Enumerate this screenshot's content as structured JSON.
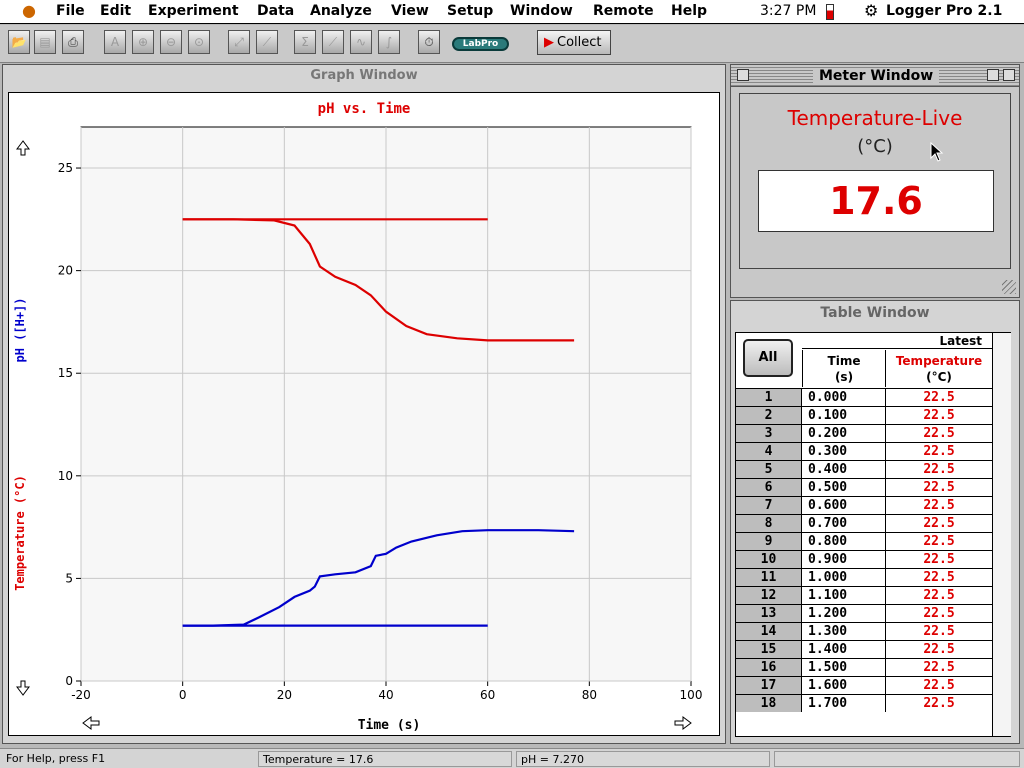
{
  "menubar": {
    "items": [
      "File",
      "Edit",
      "Experiment",
      "Data",
      "Analyze",
      "View",
      "Setup",
      "Window",
      "Remote",
      "Help"
    ],
    "clock": "3:27 PM",
    "app_name": "Logger Pro 2.1"
  },
  "toolbar": {
    "collect_label": "Collect",
    "labpro_label": "LabPro"
  },
  "graph_window": {
    "title": "Graph Window",
    "chart_title": "pH vs. Time"
  },
  "meter_window": {
    "title": "Meter Window",
    "label": "Temperature-Live",
    "unit": "(°C)",
    "value": "17.6"
  },
  "table_window": {
    "title": "Table Window",
    "all_label": "All",
    "latest_label": "Latest",
    "time_header": "Time",
    "time_unit": "(s)",
    "temp_header": "Temperature",
    "temp_unit": "(°C)",
    "rows": [
      {
        "n": "1",
        "t": "0.000",
        "v": "22.5"
      },
      {
        "n": "2",
        "t": "0.100",
        "v": "22.5"
      },
      {
        "n": "3",
        "t": "0.200",
        "v": "22.5"
      },
      {
        "n": "4",
        "t": "0.300",
        "v": "22.5"
      },
      {
        "n": "5",
        "t": "0.400",
        "v": "22.5"
      },
      {
        "n": "6",
        "t": "0.500",
        "v": "22.5"
      },
      {
        "n": "7",
        "t": "0.600",
        "v": "22.5"
      },
      {
        "n": "8",
        "t": "0.700",
        "v": "22.5"
      },
      {
        "n": "9",
        "t": "0.800",
        "v": "22.5"
      },
      {
        "n": "10",
        "t": "0.900",
        "v": "22.5"
      },
      {
        "n": "11",
        "t": "1.000",
        "v": "22.5"
      },
      {
        "n": "12",
        "t": "1.100",
        "v": "22.5"
      },
      {
        "n": "13",
        "t": "1.200",
        "v": "22.5"
      },
      {
        "n": "14",
        "t": "1.300",
        "v": "22.5"
      },
      {
        "n": "15",
        "t": "1.400",
        "v": "22.5"
      },
      {
        "n": "16",
        "t": "1.500",
        "v": "22.5"
      },
      {
        "n": "17",
        "t": "1.600",
        "v": "22.5"
      },
      {
        "n": "18",
        "t": "1.700",
        "v": "22.5"
      }
    ]
  },
  "status_bar": {
    "help": "For Help, press F1",
    "temperature": "Temperature = 17.6",
    "ph": "pH = 7.270"
  },
  "colors": {
    "temperature": "#dd0000",
    "ph": "#0000cc"
  },
  "chart_data": {
    "type": "line",
    "title": "pH vs. Time",
    "xlabel": "Time (s)",
    "ylabel_left_1": "Temperature (°C)",
    "ylabel_left_2": "pH ([H+])",
    "xlim": [
      -20,
      100
    ],
    "ylim": [
      0,
      27
    ],
    "x_ticks": [
      -20,
      0,
      20,
      40,
      60,
      80,
      100
    ],
    "y_ticks": [
      0,
      5,
      10,
      15,
      20,
      25
    ],
    "grid": true,
    "series": [
      {
        "name": "Temperature",
        "color": "#dd0000",
        "points": [
          [
            0,
            22.5
          ],
          [
            10,
            22.5
          ],
          [
            18,
            22.45
          ],
          [
            22,
            22.2
          ],
          [
            25,
            21.3
          ],
          [
            27,
            20.2
          ],
          [
            30,
            19.7
          ],
          [
            34,
            19.3
          ],
          [
            37,
            18.8
          ],
          [
            40,
            18.0
          ],
          [
            44,
            17.3
          ],
          [
            48,
            16.9
          ],
          [
            54,
            16.7
          ],
          [
            60,
            16.6
          ],
          [
            70,
            16.6
          ],
          [
            77,
            16.6
          ]
        ]
      },
      {
        "name": "Temperature",
        "color": "#dd0000",
        "points": [
          [
            0,
            22.5
          ],
          [
            60,
            22.5
          ]
        ]
      },
      {
        "name": "pH",
        "color": "#0000cc",
        "points": [
          [
            0,
            2.7
          ],
          [
            6,
            2.7
          ],
          [
            12,
            2.75
          ],
          [
            15,
            3.1
          ],
          [
            19,
            3.6
          ],
          [
            22,
            4.1
          ],
          [
            25,
            4.4
          ],
          [
            26,
            4.6
          ],
          [
            27,
            5.1
          ],
          [
            30,
            5.2
          ],
          [
            34,
            5.3
          ],
          [
            37,
            5.6
          ],
          [
            38,
            6.1
          ],
          [
            40,
            6.2
          ],
          [
            42,
            6.5
          ],
          [
            45,
            6.8
          ],
          [
            50,
            7.1
          ],
          [
            55,
            7.3
          ],
          [
            60,
            7.35
          ],
          [
            65,
            7.35
          ],
          [
            70,
            7.35
          ],
          [
            77,
            7.3
          ]
        ]
      },
      {
        "name": "pH",
        "color": "#0000cc",
        "points": [
          [
            0,
            2.7
          ],
          [
            60,
            2.7
          ]
        ]
      }
    ]
  }
}
